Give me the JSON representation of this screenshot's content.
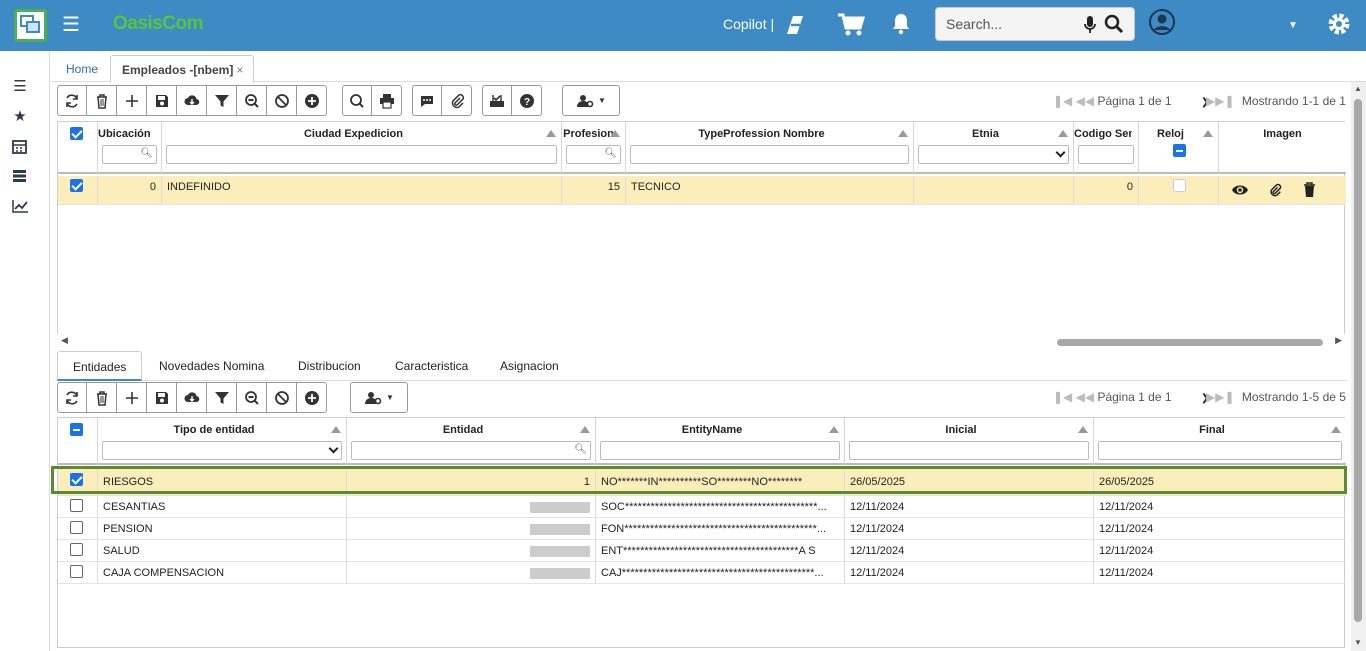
{
  "header": {
    "brand": "OasisCom",
    "copilot_label": "Copilot |",
    "search_placeholder": "Search..."
  },
  "tabs": {
    "home": "Home",
    "employees": "Empleados -[nbem]",
    "close": "×"
  },
  "top_grid": {
    "pager_text": "Página 1 de 1",
    "showing_text": "Mostrando 1-1 de 1",
    "columns": [
      "Ubicación de",
      "Ciudad Expedicion",
      "Profesion",
      "TypeProfession Nombre",
      "Etnia",
      "Codigo Sena",
      "Reloj",
      "Imagen"
    ],
    "row": {
      "ubicacion": "0",
      "ciudad": "INDEFINIDO",
      "profesion": "15",
      "type_nombre": "TECNICO",
      "etnia": "",
      "codigo": "0"
    }
  },
  "subtabs": [
    "Entidades",
    "Novedades Nomina",
    "Distribucion",
    "Caracteristica",
    "Asignacion"
  ],
  "bottom_grid": {
    "pager_text": "Página 1 de 1",
    "showing_text": "Mostrando 1-5 de 5",
    "columns": [
      "Tipo de entidad",
      "Entidad",
      "EntityName",
      "Inicial",
      "Final"
    ],
    "rows": [
      {
        "tipo": "RIESGOS",
        "entidad": "1",
        "name": "NO*******IN**********SO********NO********",
        "inicial": "26/05/2025",
        "final": "26/05/2025"
      },
      {
        "tipo": "CESANTIAS",
        "entidad": "",
        "name": "SOC*********************************************...",
        "inicial": "12/11/2024",
        "final": "12/11/2024"
      },
      {
        "tipo": "PENSION",
        "entidad": "",
        "name": "FON*********************************************...",
        "inicial": "12/11/2024",
        "final": "12/11/2024"
      },
      {
        "tipo": "SALUD",
        "entidad": "",
        "name": "ENT*****************************************A S",
        "inicial": "12/11/2024",
        "final": "12/11/2024"
      },
      {
        "tipo": "CAJA COMPENSACION",
        "entidad": "",
        "name": "CAJ*********************************************...",
        "inicial": "12/11/2024",
        "final": "12/11/2024"
      }
    ]
  },
  "colors": {
    "topbar": "#3d8ac4",
    "selected_row": "#fbeeba",
    "highlight_border": "#5c8a2e"
  }
}
